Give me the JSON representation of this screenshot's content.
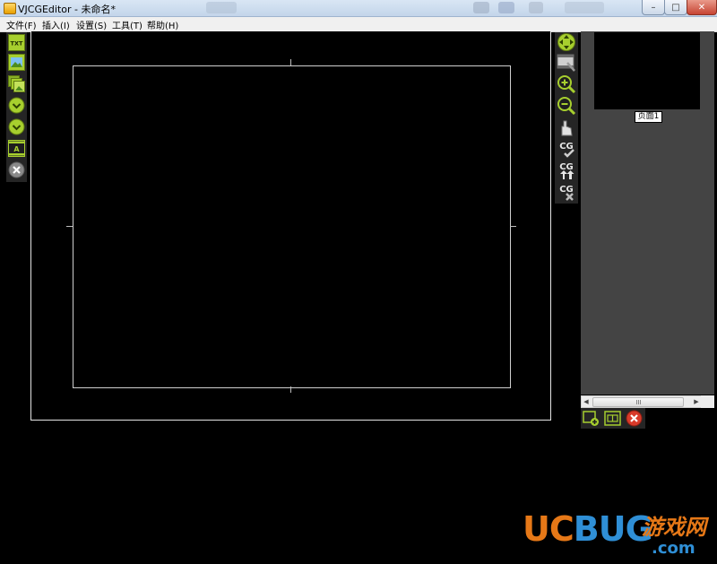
{
  "window": {
    "title": "VJCGEditor - 未命名*",
    "buttons": {
      "minimize": "–",
      "maximize": "□",
      "close": "✕"
    }
  },
  "menu": [
    {
      "label": "文件(F)"
    },
    {
      "label": "插入(I)"
    },
    {
      "label": "设置(S)"
    },
    {
      "label": "工具(T)"
    },
    {
      "label": "帮助(H)"
    }
  ],
  "left_toolbar": {
    "items": [
      {
        "icon": "insert-text-icon",
        "label": "TXT"
      },
      {
        "icon": "insert-image-icon"
      },
      {
        "icon": "insert-image-sequence-icon"
      },
      {
        "icon": "insert-clock-icon"
      },
      {
        "icon": "insert-countdown-icon"
      },
      {
        "icon": "insert-subtitle-film-icon",
        "label": "A"
      },
      {
        "icon": "delete-icon"
      }
    ]
  },
  "right_toolbar": {
    "items": [
      {
        "icon": "fit-view-icon"
      },
      {
        "icon": "background-film-icon"
      },
      {
        "icon": "zoom-in-icon"
      },
      {
        "icon": "zoom-out-icon"
      },
      {
        "icon": "hand-pan-icon"
      },
      {
        "icon": "cg-apply-icon",
        "label": "CG"
      },
      {
        "icon": "cg-upload-icon",
        "label": "CG"
      },
      {
        "icon": "cg-remove-icon",
        "label": "CG"
      }
    ]
  },
  "pages": {
    "items": [
      {
        "label": "页面1"
      }
    ],
    "tools": [
      {
        "icon": "add-page-icon"
      },
      {
        "icon": "page-properties-icon"
      },
      {
        "icon": "delete-page-icon"
      }
    ]
  },
  "watermark": {
    "brand": "UCBUG",
    "site": "游戏网",
    "domain": ".com"
  },
  "colors": {
    "toolbar_bg": "#252525",
    "icon_green": "#9ec82c",
    "page_panel_bg": "#444444",
    "canvas_bg": "#000000",
    "watermark_orange": "#e67817",
    "watermark_blue": "#2f8fd6"
  }
}
